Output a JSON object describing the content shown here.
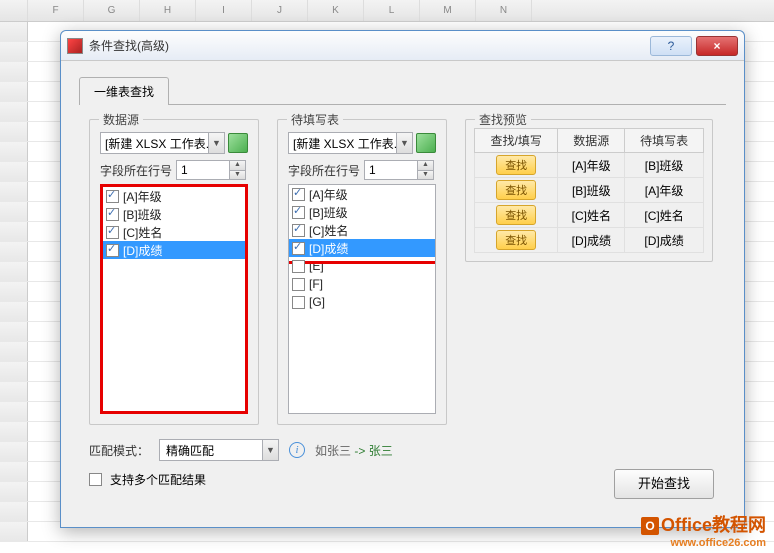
{
  "sheet": {
    "columns": [
      "F",
      "G",
      "H",
      "I",
      "J",
      "K",
      "L",
      "M",
      "N"
    ]
  },
  "dialog": {
    "title": "条件查找(高级)"
  },
  "tab": {
    "label": "一维表查找"
  },
  "source_group": {
    "title": "数据源",
    "workbook": "[新建 XLSX 工作表.x",
    "row_label": "字段所在行号",
    "row_value": "1",
    "items": [
      {
        "label": "[A]年级",
        "checked": true,
        "selected": false
      },
      {
        "label": "[B]班级",
        "checked": true,
        "selected": false
      },
      {
        "label": "[C]姓名",
        "checked": true,
        "selected": false
      },
      {
        "label": "[D]成绩",
        "checked": true,
        "selected": true
      }
    ]
  },
  "target_group": {
    "title": "待填写表",
    "workbook": "[新建 XLSX 工作表.x",
    "row_label": "字段所在行号",
    "row_value": "1",
    "items": [
      {
        "label": "[A]年级",
        "checked": true,
        "selected": false
      },
      {
        "label": "[B]班级",
        "checked": true,
        "selected": false
      },
      {
        "label": "[C]姓名",
        "checked": true,
        "selected": false
      },
      {
        "label": "[D]成绩",
        "checked": true,
        "selected": true
      },
      {
        "label": "[E]",
        "checked": false,
        "selected": false
      },
      {
        "label": "[F]",
        "checked": false,
        "selected": false
      },
      {
        "label": "[G]",
        "checked": false,
        "selected": false
      }
    ]
  },
  "preview_group": {
    "title": "查找预览",
    "headers": [
      "查找/填写",
      "数据源",
      "待填写表"
    ],
    "action_label": "查找",
    "rows": [
      {
        "src": "[A]年级",
        "tgt": "[B]班级"
      },
      {
        "src": "[B]班级",
        "tgt": "[A]年级"
      },
      {
        "src": "[C]姓名",
        "tgt": "[C]姓名"
      },
      {
        "src": "[D]成绩",
        "tgt": "[D]成绩"
      }
    ]
  },
  "match": {
    "label": "匹配模式：",
    "value": "精确匹配",
    "hint_pre": "如张三",
    "hint_arrow": " -> ",
    "hint_post": "张三"
  },
  "multi": {
    "label": "支持多个匹配结果",
    "checked": false
  },
  "start_label": "开始查找",
  "watermark": {
    "brand": "Office教程网",
    "url": "www.office26.com"
  }
}
